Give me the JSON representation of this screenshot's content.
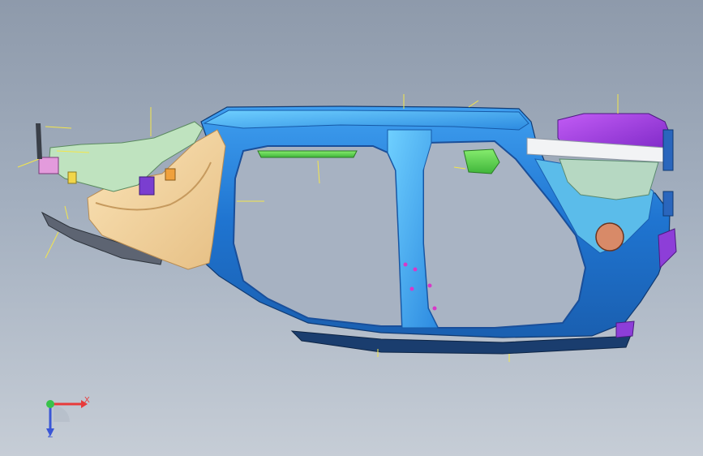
{
  "viewport": {
    "background_top": "#8e9aab",
    "background_bottom": "#c6cdd6"
  },
  "model": {
    "part_colors": {
      "body_side_outer": "#1f74d0",
      "body_side_light": "#4cb2f0",
      "fender": "#f3d6a4",
      "rear_panel": "#9a3be0",
      "green_bracket": "#52d24c",
      "front_rail": "#bfe3bf",
      "rocker": "#1a3d6e"
    }
  },
  "triad": {
    "x_label": "X",
    "z_label": "Z",
    "x_color": "#e83a3a",
    "y_color": "#38c24a",
    "z_color": "#3a56d6"
  }
}
